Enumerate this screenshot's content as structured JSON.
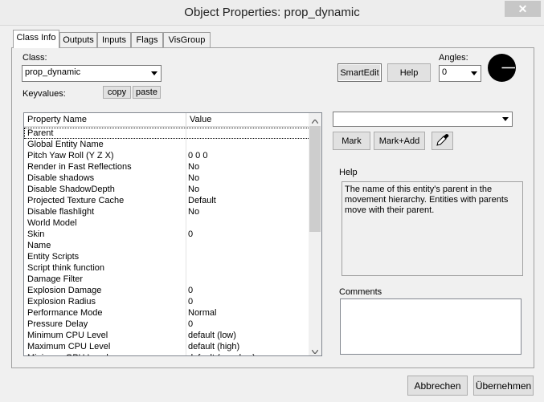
{
  "window": {
    "title": "Object Properties: prop_dynamic",
    "close_label": "✕"
  },
  "tabs": [
    {
      "label": "Class Info"
    },
    {
      "label": "Outputs"
    },
    {
      "label": "Inputs"
    },
    {
      "label": "Flags"
    },
    {
      "label": "VisGroup"
    }
  ],
  "class_info": {
    "class_label": "Class:",
    "class_value": "prop_dynamic",
    "keyvalues_label": "Keyvalues:",
    "copy_label": "copy",
    "paste_label": "paste",
    "smartedit_label": "SmartEdit",
    "help_button_label": "Help",
    "angles_label": "Angles:",
    "angles_value": "0"
  },
  "property_list": {
    "headers": {
      "name": "Property Name",
      "value": "Value"
    },
    "rows": [
      {
        "name": "Parent",
        "value": ""
      },
      {
        "name": "Global Entity Name",
        "value": ""
      },
      {
        "name": "Pitch Yaw Roll (Y Z X)",
        "value": "0 0 0"
      },
      {
        "name": "Render in Fast Reflections",
        "value": "No"
      },
      {
        "name": "Disable shadows",
        "value": "No"
      },
      {
        "name": "Disable ShadowDepth",
        "value": "No"
      },
      {
        "name": "Projected Texture Cache",
        "value": "Default"
      },
      {
        "name": "Disable flashlight",
        "value": "No"
      },
      {
        "name": "World Model",
        "value": ""
      },
      {
        "name": "Skin",
        "value": "0"
      },
      {
        "name": "Name",
        "value": ""
      },
      {
        "name": "Entity Scripts",
        "value": ""
      },
      {
        "name": "Script think function",
        "value": ""
      },
      {
        "name": "Damage Filter",
        "value": ""
      },
      {
        "name": "Explosion Damage",
        "value": "0"
      },
      {
        "name": "Explosion Radius",
        "value": "0"
      },
      {
        "name": "Performance Mode",
        "value": "Normal"
      },
      {
        "name": "Pressure Delay",
        "value": "0"
      },
      {
        "name": "Minimum CPU Level",
        "value": "default (low)"
      },
      {
        "name": "Maximum CPU Level",
        "value": "default (high)"
      },
      {
        "name": "Minimum GPU Level",
        "value": "default (very low)"
      }
    ]
  },
  "right_panel": {
    "value_combo": "",
    "mark_label": "Mark",
    "markadd_label": "Mark+Add",
    "help_label": "Help",
    "help_text": "The name of this entity's parent in the movement hierarchy. Entities with parents move with their parent.",
    "comments_label": "Comments"
  },
  "dialog": {
    "cancel_label": "Abbrechen",
    "apply_label": "Übernehmen"
  },
  "icons": {
    "eyedropper": "eyedropper-icon",
    "angle_dial": "angle-dial-icon"
  }
}
